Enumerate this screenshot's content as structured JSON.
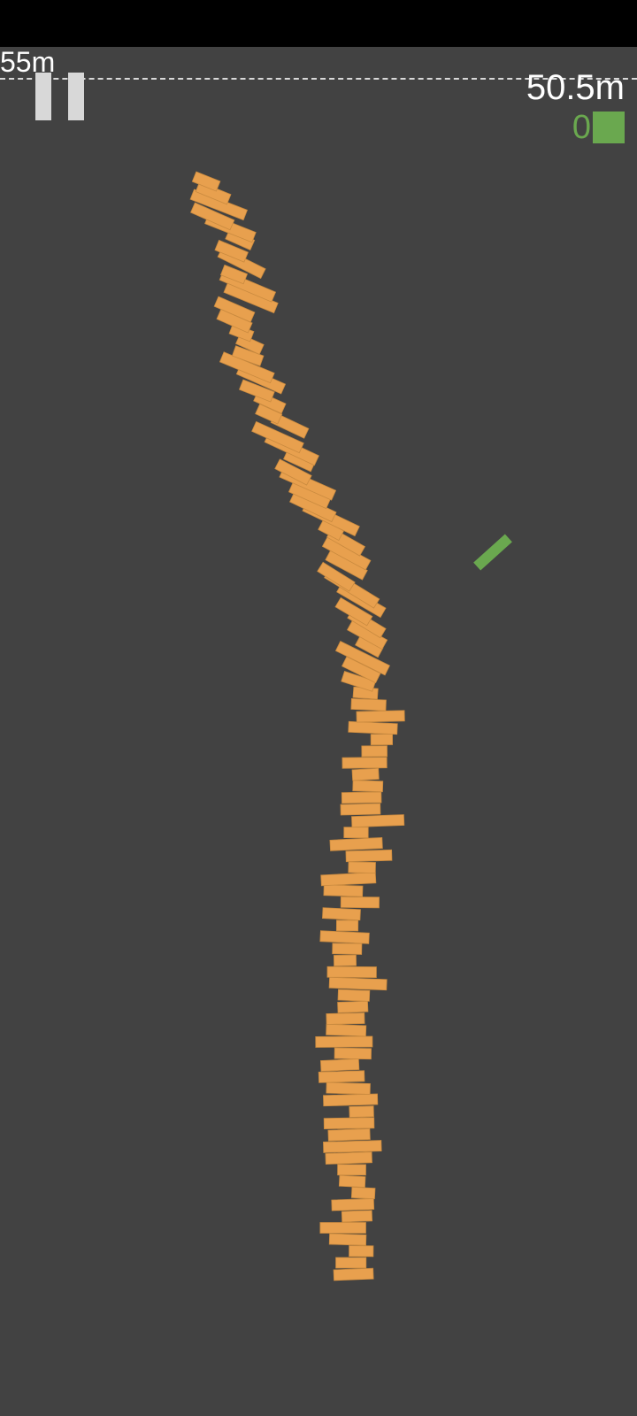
{
  "hud": {
    "goal_label": "55m",
    "height_readout": "50.5m",
    "blocks_remaining": "0"
  },
  "tower": {
    "block_count": 95,
    "tower_height_m": 50.5
  },
  "falling_block": {
    "angle_deg": -42
  },
  "icons": {
    "pause": "pause-icon",
    "block": "block-icon"
  },
  "colors": {
    "background": "#424242",
    "block": "#e8a04e",
    "block_outline": "#c98a3f",
    "active_block": "#6aa84f",
    "status_bar": "#000000",
    "goal_line": "#d9d9d9"
  }
}
